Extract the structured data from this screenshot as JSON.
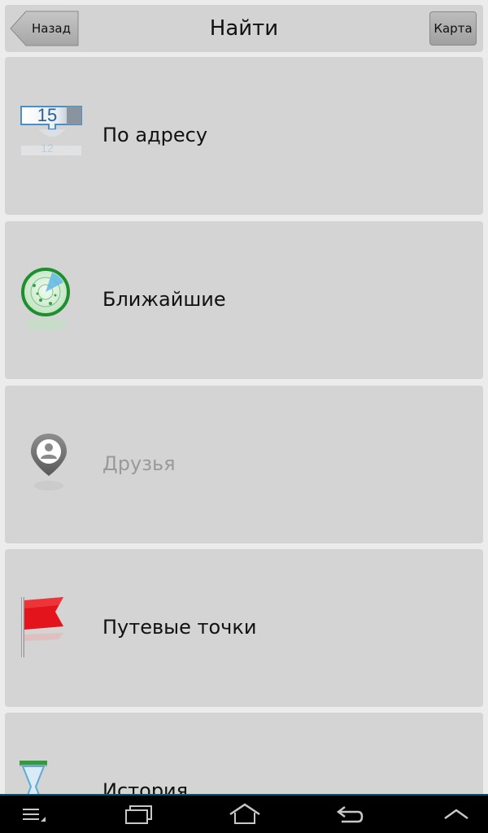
{
  "header": {
    "back_label": "Назад",
    "title": "Найти",
    "map_label": "Карта"
  },
  "items": [
    {
      "label": "По адресу",
      "icon": "address-number-icon",
      "enabled": true,
      "number": "15"
    },
    {
      "label": "Ближайшие",
      "icon": "radar-icon",
      "enabled": true
    },
    {
      "label": "Друзья",
      "icon": "friend-pin-icon",
      "enabled": false
    },
    {
      "label": "Путевые точки",
      "icon": "red-flag-icon",
      "enabled": true
    },
    {
      "label": "История",
      "icon": "hourglass-icon",
      "enabled": true
    }
  ],
  "navbar": {
    "buttons": [
      "menu-icon",
      "recent-apps-icon",
      "home-icon",
      "back-arrow-icon",
      "expand-up-icon"
    ]
  },
  "colors": {
    "background": "#ececec",
    "tile": "#d4d4d4",
    "text": "#111111",
    "disabled_text": "#9a9a9a",
    "navbar": "#000000",
    "navbar_border": "#0e4f6b"
  }
}
